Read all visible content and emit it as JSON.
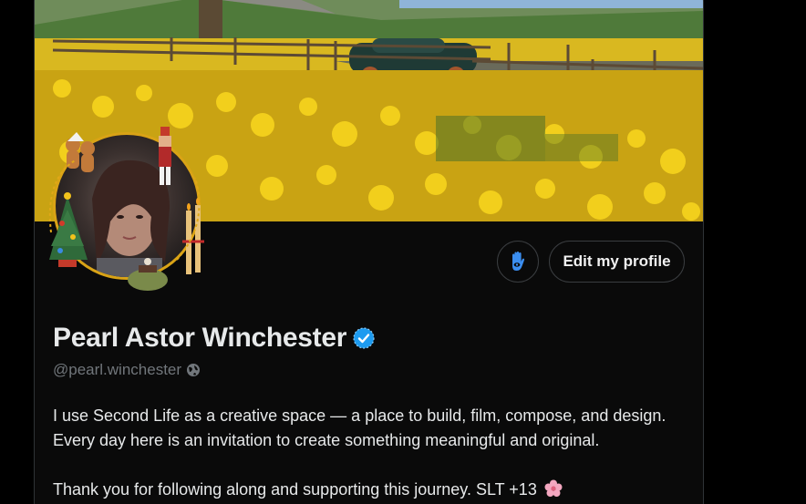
{
  "profile": {
    "display_name": "Pearl Astor Winchester",
    "handle": "@pearl.winchester",
    "verified": true,
    "bio_line_1": "I use Second Life as a creative space — a place to build, film, compose, and design.",
    "bio_line_2": "Every day here is an invitation to create something meaningful and original.",
    "bio_line_3": "Thank you for following along and supporting this journey. SLT +13"
  },
  "actions": {
    "edit_label": "Edit my profile",
    "icon_button": "hand-eye-icon"
  },
  "colors": {
    "background": "#000000",
    "card": "#0a0a0a",
    "text_primary": "#e7e9ea",
    "text_secondary": "#71767b",
    "verified_blue": "#1d9bf0",
    "accent_icon": "#3b8ef0"
  },
  "icons": {
    "verified": "verified-badge-icon",
    "globe": "globe-icon",
    "flower": "cherry-blossom-icon"
  }
}
